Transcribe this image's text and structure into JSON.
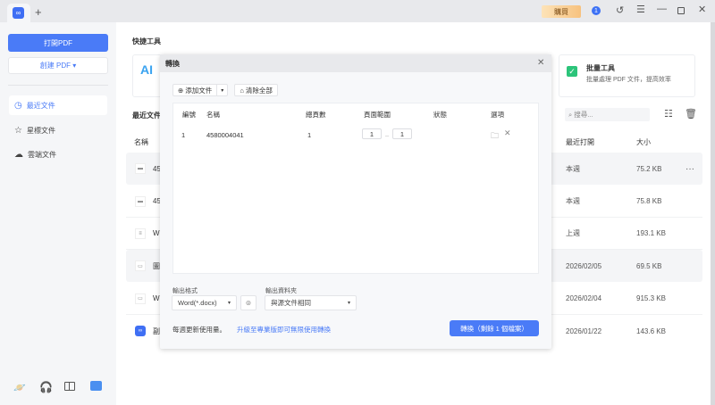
{
  "titlebar": {
    "buy_label": "購買",
    "notification_count": "1",
    "new_tab": "+"
  },
  "sidebar": {
    "open_pdf": "打開PDF",
    "create_pdf": "創建 PDF ▾",
    "items": [
      {
        "label": "最近文件",
        "icon": "clock-icon"
      },
      {
        "label": "星標文件",
        "icon": "star-icon"
      },
      {
        "label": "雲端文件",
        "icon": "cloud-icon"
      }
    ]
  },
  "main": {
    "quick_tools_title": "快捷工具",
    "ai_label": "AI",
    "batch_tool": {
      "title": "批量工具",
      "desc": "批量處理 PDF 文件，提高效率"
    },
    "recent_title": "最近文件",
    "search_placeholder": "搜尋...",
    "columns": {
      "name": "名稱",
      "opened": "最近打開",
      "size": "大小"
    },
    "files": [
      {
        "name": "45",
        "opened": "本週",
        "size": "75.2 KB"
      },
      {
        "name": "45",
        "opened": "本週",
        "size": "75.8 KB"
      },
      {
        "name": "W",
        "opened": "上週",
        "size": "193.1 KB"
      },
      {
        "name": "圖",
        "opened": "2026/02/05",
        "size": "69.5 KB"
      },
      {
        "name": "W",
        "opened": "2026/02/04",
        "size": "915.3 KB"
      },
      {
        "name": "副",
        "opened": "2026/01/22",
        "size": "143.6 KB"
      }
    ],
    "more": "···"
  },
  "dialog": {
    "title": "轉換",
    "add_file": "添加文件",
    "clear_all": "清除全部",
    "columns": [
      "編號",
      "名稱",
      "總頁數",
      "頁面範圍",
      "狀態",
      "選項"
    ],
    "rows": [
      {
        "index": "1",
        "name": "4580004041",
        "pages": "1",
        "from": "1",
        "to": "1"
      }
    ],
    "output_format_label": "輸出格式",
    "output_format": "Word(*.docx)",
    "output_folder_label": "輸出資料夾",
    "output_folder": "與源文件相同",
    "usage_note": "每週更新使用量。",
    "upgrade_link": "升級至專業版即可無限使用轉換",
    "convert_button": "轉換（剩餘 1 個檔案）"
  }
}
